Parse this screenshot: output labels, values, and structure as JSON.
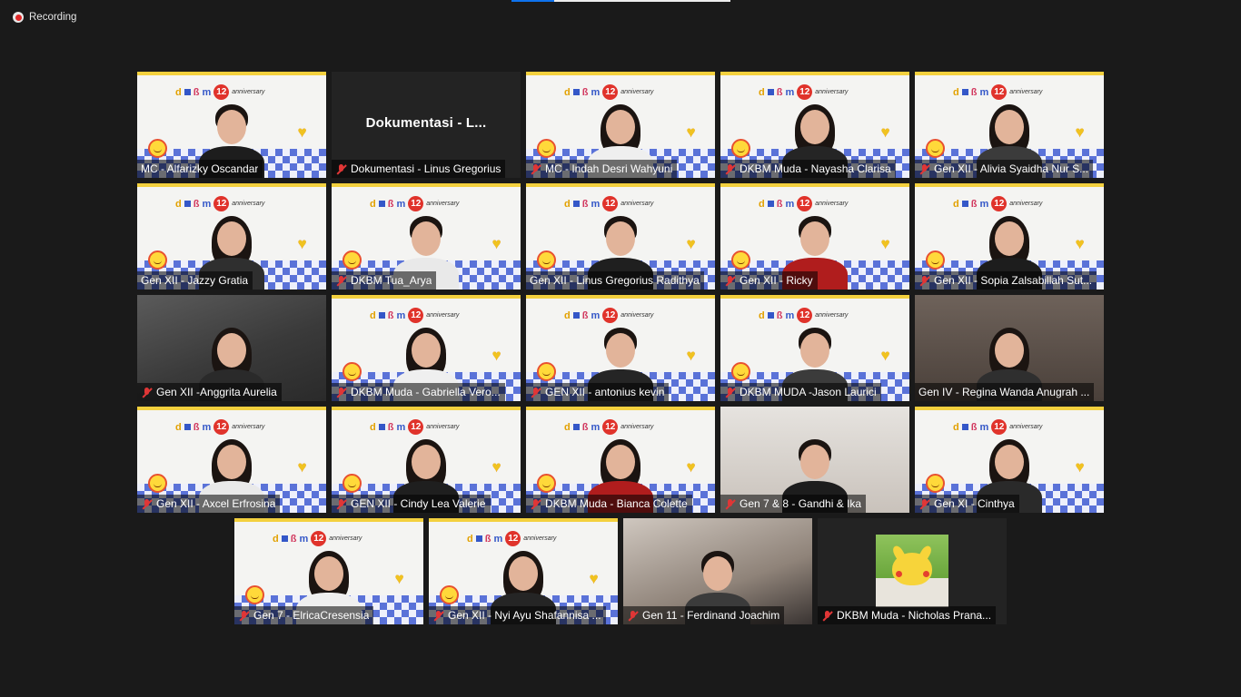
{
  "recording": {
    "label": "Recording"
  },
  "placeholder_tile": {
    "display_name": "Dokumentasi  -  L..."
  },
  "tiles": [
    {
      "name": "MC - Alfarizky Oscandar",
      "muted": false
    },
    {
      "name": "Dokumentasi - Linus Gregorius",
      "muted": true
    },
    {
      "name": "MC - Indah Desri Wahyuni",
      "muted": true
    },
    {
      "name": "DKBM Muda - Nayasha Clarisa",
      "muted": true
    },
    {
      "name": "Gen XII - Alivia Syaidha Nur S...",
      "muted": true
    },
    {
      "name": "Gen XII - Jazzy Gratia",
      "muted": false
    },
    {
      "name": "DKBM Tua_Arya",
      "muted": true
    },
    {
      "name": "Gen XII - Linus Gregorius Radithya",
      "muted": false
    },
    {
      "name": "Gen XII - Ricky",
      "muted": true
    },
    {
      "name": "Gen XII - Sopia Zalsabillah Sut...",
      "muted": true
    },
    {
      "name": "Gen XII -Anggrita Aurelia",
      "muted": true
    },
    {
      "name": "DKBM Muda - Gabriella Vero...",
      "muted": true
    },
    {
      "name": "GEN XII - antonius kevin",
      "muted": true
    },
    {
      "name": "DKBM MUDA -Jason Laurici",
      "muted": true
    },
    {
      "name": "Gen IV - Regina Wanda Anugrah ...",
      "muted": false
    },
    {
      "name": "Gen XII - Axcel Erfrosina",
      "muted": true
    },
    {
      "name": "GEN XII - Cindy Lea Valerie",
      "muted": true
    },
    {
      "name": "DKBM Muda - Bianca Colette",
      "muted": true
    },
    {
      "name": "Gen 7 & 8 - Gandhi & Ika",
      "muted": true
    },
    {
      "name": "Gen XI - Cinthya",
      "muted": true
    },
    {
      "name": "Gen 7 - ElricaCresensia",
      "muted": true
    },
    {
      "name": "Gen XII - Nyi Ayu Shafannisa ...",
      "muted": true
    },
    {
      "name": "Gen 11 - Ferdinand Joachim",
      "muted": true
    },
    {
      "name": "DKBM Muda - Nicholas Prana...",
      "muted": true
    }
  ],
  "banner": {
    "badge": "12",
    "tagline": "anniversary"
  },
  "colors": {
    "background": "#1a1a1a",
    "active_speaker": "#9bd12d",
    "muted_mic": "#e03636",
    "recording_dot": "#e02828"
  },
  "icons": [
    "recording-icon",
    "mic-muted-icon",
    "smiley-sticker-icon",
    "heart-sticker-icon"
  ]
}
